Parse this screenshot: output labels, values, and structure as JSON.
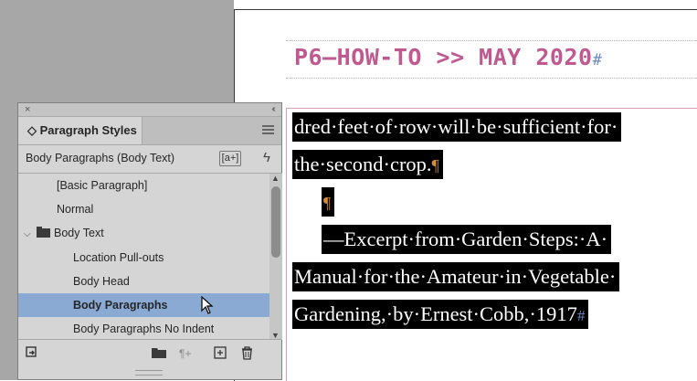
{
  "document": {
    "header": "P6—HOW-TO >> MAY 2020",
    "body_lines": [
      {
        "text": "dred·feet·of·row·will·be·sufficient·for·",
        "end": ""
      },
      {
        "text": "the·second·crop.",
        "end": "¶"
      },
      {
        "text": "",
        "end": "¶"
      },
      {
        "text": "—Excerpt·from·Garden·Steps:·A·",
        "end": ""
      },
      {
        "text": "Manual·for·the·Amateur·in·Vegetable·",
        "end": ""
      },
      {
        "text": "Gardening,·by·Ernest·Cobb,·1917",
        "end": "#"
      }
    ]
  },
  "panel": {
    "close_glyph": "×",
    "collapse_glyph": "‹‹",
    "tab_label": "◇ Paragraph Styles",
    "current_style": "Body Paragraphs (Body Text)",
    "new_style_override_label": "[a+]",
    "items": [
      {
        "label": "[Basic Paragraph]",
        "level": 1,
        "selected": false
      },
      {
        "label": "Normal",
        "level": 1,
        "selected": false
      },
      {
        "label": "Body Text",
        "level": 0,
        "selected": false,
        "folder": true
      },
      {
        "label": "Location Pull-outs",
        "level": 2,
        "selected": false
      },
      {
        "label": "Body Head",
        "level": 2,
        "selected": false
      },
      {
        "label": "Body Paragraphs",
        "level": 2,
        "selected": true
      },
      {
        "label": "Body Paragraphs No Indent",
        "level": 2,
        "selected": false
      }
    ],
    "bottom_icons": [
      "load-styles-icon",
      "folder-icon",
      "clear-overrides-icon",
      "new-style-icon",
      "trash-icon"
    ]
  },
  "colors": {
    "selection": "#000000",
    "header_text": "#c0598f",
    "selected_item": "#8aa9d3",
    "pasteboard": "#a7a7a7"
  }
}
